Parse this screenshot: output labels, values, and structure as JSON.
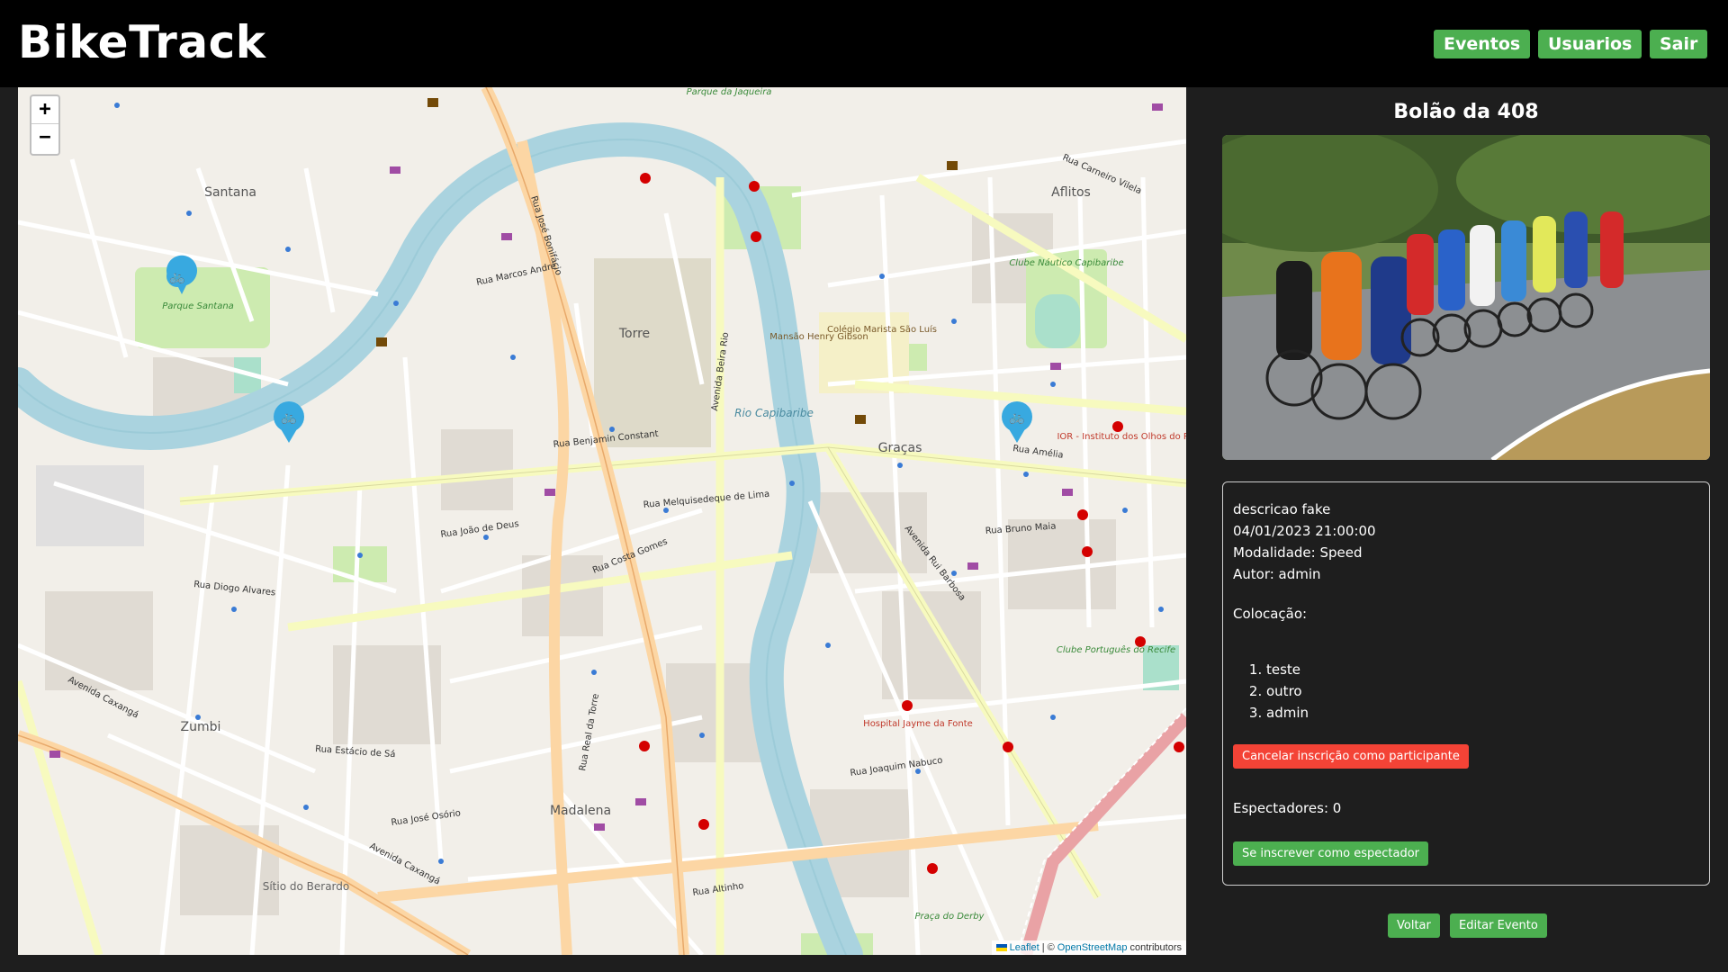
{
  "header": {
    "brand": "BikeTrack",
    "nav": {
      "events": "Eventos",
      "users": "Usuarios",
      "logout": "Sair"
    }
  },
  "map": {
    "zoom_in": "+",
    "zoom_out": "−",
    "attribution": {
      "leaflet": "Leaflet",
      "separator": "| ©",
      "osm": "OpenStreetMap",
      "suffix": "contributors"
    },
    "labels": {
      "santana": "Santana",
      "aflitos": "Aflitos",
      "torre": "Torre",
      "gracas": "Graças",
      "zumbi": "Zumbi",
      "madalena": "Madalena",
      "rio": "Rio Capibaribe",
      "parque_jaqueira": "Parque da Jaqueira",
      "parque_santana": "Parque Santana",
      "sitio_berardo": "Sítio do Berardo",
      "hospital": "Hospital Jayme da Fonte",
      "r_amelia": "Rua Amélia",
      "r_melquisedeque": "Rua Melquisedeque de Lima",
      "av_caxanga": "Avenida Caxangá",
      "r_jose_osorio": "Rua José Osório",
      "r_joaquim_nabuco": "Rua Joaquim Nabuco",
      "r_bonifacio": "Rua José Bonifácio",
      "r_real_torre": "Rua Real da Torre",
      "av_rui_barbosa": "Avenida Rui Barbosa",
      "av_beira_rio": "Avenida Beira Rio",
      "r_benjamin": "Rua Benjamin Constant",
      "r_joao_deus": "Rua João de Deus",
      "r_costa_gomes": "Rua Costa Gomes",
      "r_diogo_alvares": "Rua Diogo Alvares",
      "r_estacio": "Rua Estácio de Sá",
      "r_altinho": "Rua Altinho",
      "r_bruno_maia": "Rua Bruno Maia",
      "r_marcos_andre": "Rua Marcos André",
      "r_carneiro_vilela": "Rua Carneiro Vilela",
      "clube_nautico": "Clube Náutico Capibaribe",
      "clube_portugues": "Clube Português do Recife",
      "ior": "IOR - Instituto dos Olhos do Recife",
      "colegio_marista": "Colégio Marista São Luís",
      "mansao": "Mansão Henry Gibson",
      "praca_derby": "Praça do Derby"
    }
  },
  "event": {
    "title": "Bolão da 408",
    "description": "descricao fake",
    "datetime": "04/01/2023 21:00:00",
    "modality": "Modalidade: Speed",
    "author": "Autor: admin",
    "ranking_label": "Colocação:",
    "ranking": [
      "teste",
      "outro",
      "admin"
    ],
    "cancel_participant": "Cancelar inscrição como participante",
    "spectators": "Espectadores: 0",
    "subscribe_spectator": "Se inscrever como espectador"
  },
  "actions": {
    "back": "Voltar",
    "edit": "Editar Evento"
  },
  "colors": {
    "accent_green": "#4caf50",
    "danger_red": "#f44336",
    "header_bg": "#000000",
    "page_bg": "#1e1e1e",
    "river": "#aad3df",
    "major_road": "#fcd6a4",
    "secondary_road": "#f7fabf"
  }
}
